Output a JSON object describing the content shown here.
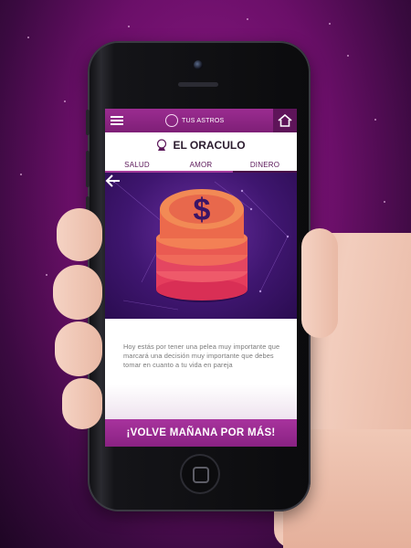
{
  "app": {
    "brand": "TUS ASTROS",
    "title": "EL ORACULO"
  },
  "tabs": [
    {
      "label": "SALUD"
    },
    {
      "label": "AMOR"
    },
    {
      "label": "DINERO"
    }
  ],
  "selected_tab": "DINERO",
  "message": "Hoy estás por tener una pelea muy importante que marcará una decisión muy importante que debes tomar en cuanto a tu vida en pareja",
  "cta": "¡VOLVE MAÑANA POR MÁS!",
  "icons": {
    "menu": "hamburger-icon",
    "logo": "astro-logo-icon",
    "home": "home-icon",
    "oracle": "crystal-ball-icon",
    "hero": "dollar-coin-stack-icon",
    "back": "arrow-left-icon"
  },
  "colors": {
    "brand_purple": "#9b2c91",
    "dark_purple": "#5e1459",
    "coin_orange": "#e8684c",
    "coin_pink": "#e53d5d"
  }
}
